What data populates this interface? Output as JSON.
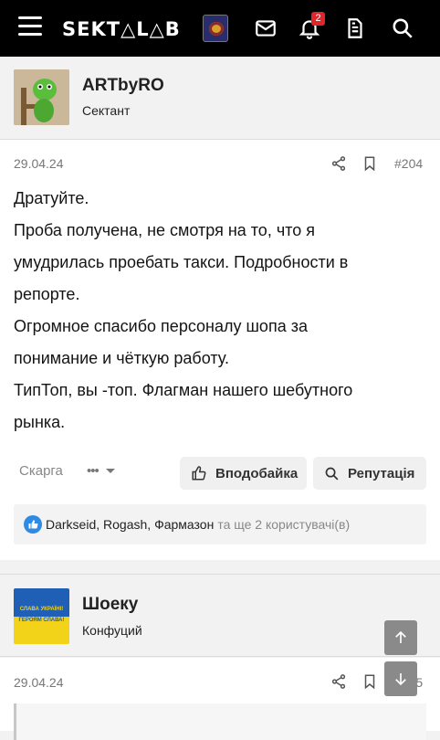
{
  "header": {
    "logo": "SEKT△L△B",
    "notifications_count": "2",
    "icons": [
      "menu-icon",
      "mail-icon",
      "bell-icon",
      "document-icon",
      "search-icon"
    ]
  },
  "post1": {
    "author": "ARTbyRO",
    "author_title": "Сектант",
    "date": "29.04.24",
    "number": "#204",
    "lines": [
      "Дратуйте.",
      "Проба получена, не смотря на то, что я",
      "умудрилась проебать такси. Подробности в",
      "репорте.",
      "Огромное спасибо персоналу шопа за",
      "понимание и чёткую работу.",
      "ТипТоп, вы -топ. Флагман нашего шебутного",
      "рынка."
    ],
    "report_label": "Скарга",
    "more_label": "•••",
    "like_label": "Вподобайка",
    "reputation_label": "Репутація",
    "reaction_users": [
      "Darkseid",
      "Rogash",
      "Фармазон"
    ],
    "reaction_more": "та ще 2 користувачі(в)"
  },
  "post2": {
    "author": "Шоеку",
    "author_title": "Конфуций",
    "avatar_text_1": "СЛАВА УКРАЇНІ!",
    "avatar_text_2": "ГЕРОЯМ СЛАВА!",
    "date": "29.04.24",
    "number": "#205"
  },
  "colors": {
    "topbar": "#000000",
    "badge": "#e0262b",
    "like_blue": "#2f8ae3",
    "flag_blue": "#1f5fb5",
    "flag_yellow": "#f3d21a"
  }
}
